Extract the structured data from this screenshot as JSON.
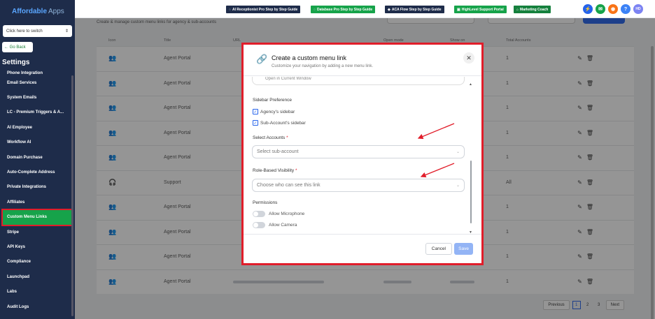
{
  "sidebar": {
    "logo_main": "Affordable",
    "logo_suffix": "Apps",
    "switcher_label": "Click here to switch",
    "go_back": "← Go Back",
    "settings_title": "Settings",
    "items": [
      "Phone Integration",
      "Email Services",
      "System Emails",
      "LC - Premium Triggers & A...",
      "AI Employee",
      "Workflow AI",
      "Domain Purchase",
      "Auto-Complete Address",
      "Private Integrations",
      "Affiliates",
      "Custom Menu Links",
      "Stripe",
      "API Keys",
      "Compliance",
      "Launchpad",
      "Labs",
      "Audit Logs"
    ]
  },
  "topbar": {
    "buttons": [
      {
        "label": "AI Receptionist Pro Step by Step Guide",
        "color": "#1e2c4a",
        "icon": "chat-icon"
      },
      {
        "label": "Database Pro Step by Step Guide",
        "color": "#16a34a",
        "icon": "chat-icon"
      },
      {
        "label": "ACA Flow Step by Step Guide",
        "color": "#1e2c4a",
        "icon": "tag-icon"
      },
      {
        "label": "HighLevel Support Portal",
        "color": "#16a34a",
        "icon": "user-icon"
      },
      {
        "label": "Marketing Coach",
        "color": "#15803d",
        "icon": "home-icon"
      }
    ],
    "avatar": "HD"
  },
  "main": {
    "subtitle": "Create & manage custom menu links for agency & sub-accounts",
    "headers": [
      "Icon",
      "Title",
      "URL",
      "Open mode",
      "Show on",
      "Total Accounts"
    ],
    "rows": [
      {
        "title": "Agent Portal",
        "total": "1"
      },
      {
        "title": "Agent Portal",
        "total": "1"
      },
      {
        "title": "Agent Portal",
        "total": "1"
      },
      {
        "title": "Agent Portal",
        "total": "1"
      },
      {
        "title": "Agent Portal",
        "total": "1"
      },
      {
        "title": "Support",
        "total": "All"
      },
      {
        "title": "Agent Portal",
        "total": "1"
      },
      {
        "title": "Agent Portal",
        "total": "1"
      },
      {
        "title": "Agent Portal",
        "total": "1"
      },
      {
        "title": "Agent Portal",
        "total": "1"
      }
    ],
    "pagination": {
      "previous": "Previous",
      "pages": [
        "1",
        "2",
        "3"
      ],
      "current": "1",
      "next": "Next"
    }
  },
  "modal": {
    "title": "Create a custom menu link",
    "description": "Customize your navigation by adding a new menu link.",
    "partial_option": "Open in Current Window",
    "sidebar_preference": "Sidebar Preference",
    "agency_sidebar": "Agency's sidebar",
    "subaccount_sidebar": "Sub-Account's sidebar",
    "select_accounts_label": "Select Accounts",
    "select_accounts_placeholder": "Select sub-account",
    "role_label": "Role-Based Visibility",
    "role_placeholder": "Choose who can see this link",
    "required_mark": "*",
    "permissions": "Permissions",
    "allow_microphone": "Allow Microphone",
    "allow_camera": "Allow Camera",
    "cancel": "Cancel",
    "save": "Save"
  },
  "colors": {
    "sidebar_bg": "#1e2c4a",
    "active_item": "#16a34a",
    "highlight": "#e11d2a",
    "primary": "#2563eb"
  }
}
